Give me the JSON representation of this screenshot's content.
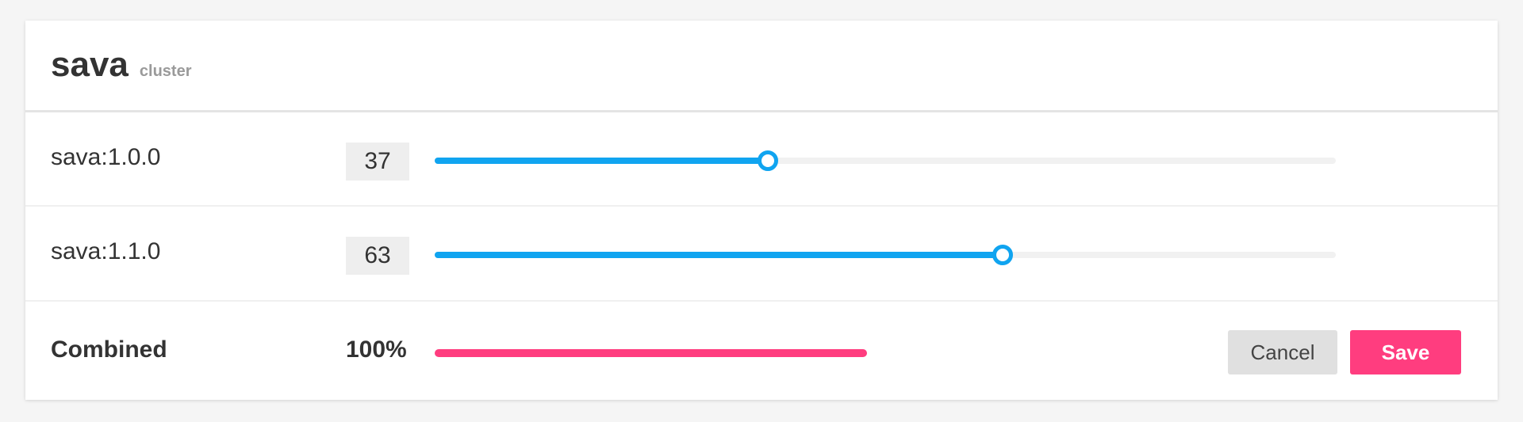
{
  "header": {
    "title": "sava",
    "subtitle": "cluster"
  },
  "versions": [
    {
      "label": "sava:1.0.0",
      "value": "37",
      "percent": 37
    },
    {
      "label": "sava:1.1.0",
      "value": "63",
      "percent": 63
    }
  ],
  "combined": {
    "label": "Combined",
    "value": "100%",
    "bar_fraction": 0.48
  },
  "buttons": {
    "cancel_label": "Cancel",
    "save_label": "Save"
  },
  "colors": {
    "slider_accent": "#10a4f0",
    "combined_accent": "#ff3d7f",
    "save_button": "#ff3d7f",
    "cancel_button": "#e0e0e0"
  }
}
